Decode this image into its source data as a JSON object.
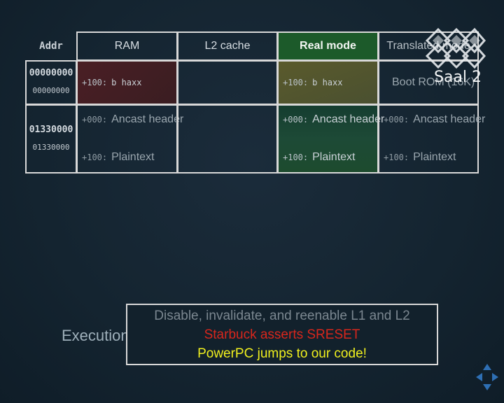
{
  "table": {
    "headers": {
      "addr": "Addr",
      "ram": "RAM",
      "l2": "L2 cache",
      "real": "Real mode",
      "translated": "Translated mode"
    },
    "rows": [
      {
        "addr_main": "00000000",
        "addr_sub": "00000000",
        "ram": {
          "offset": "+100:",
          "text": "b haxx"
        },
        "real": {
          "offset": "+100:",
          "text": "b haxx"
        },
        "translated": "Boot ROM (16K)"
      },
      {
        "addr_main": "01330000",
        "addr_sub": "01330000",
        "ram": [
          {
            "offset": "+000:",
            "text": "Ancast header"
          },
          {
            "offset": "+100:",
            "text": "Plaintext"
          }
        ],
        "real": [
          {
            "offset": "+000:",
            "text": "Ancast header"
          },
          {
            "offset": "+100:",
            "text": "Plaintext"
          }
        ],
        "translated": [
          {
            "offset": "+000:",
            "text": "Ancast header"
          },
          {
            "offset": "+100:",
            "text": "Plaintext"
          }
        ]
      }
    ]
  },
  "logo": {
    "text": "Saal 2"
  },
  "execution": {
    "label": "Execution:",
    "steps": [
      "Disable, invalidate, and reenable L1 and L2",
      "Starbuck asserts SRESET",
      "PowerPC jumps to our code!"
    ]
  },
  "colors": {
    "background": "#142430",
    "real_header": "#1c5a2a",
    "ram_haxx": "#4a1f24",
    "real_haxx": "#5a5a2c",
    "step_done": "#7b8790",
    "step_red": "#d8261c",
    "step_yellow": "#f0f01e"
  },
  "icons": [
    "saal-logo-icon",
    "navigation-arrows-icon"
  ]
}
